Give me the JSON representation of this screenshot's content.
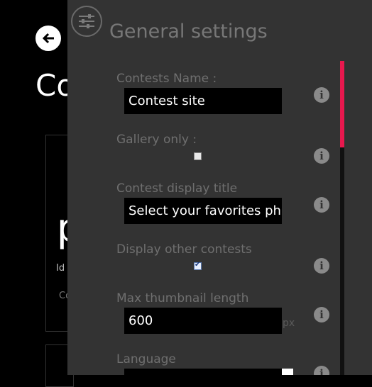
{
  "background": {
    "title": "Co",
    "big_text": "p",
    "small_text_1": "Id",
    "small_text_2": "Co"
  },
  "panel": {
    "title": "General settings",
    "fields": {
      "contests_name": {
        "label": "Contests Name :",
        "value": "Contest site"
      },
      "gallery_only": {
        "label": "Gallery only :",
        "checked": false
      },
      "display_title": {
        "label": "Contest display title",
        "value": "Select your favorites pho"
      },
      "display_other": {
        "label": "Display other contests",
        "checked": true
      },
      "max_thumb": {
        "label": "Max thumbnail length",
        "value": "600",
        "unit": "px"
      },
      "language": {
        "label": "Language"
      }
    },
    "info_glyph": "i"
  },
  "colors": {
    "accent": "#e8184e",
    "panel_bg": "#333333",
    "app_bg": "#000000"
  }
}
